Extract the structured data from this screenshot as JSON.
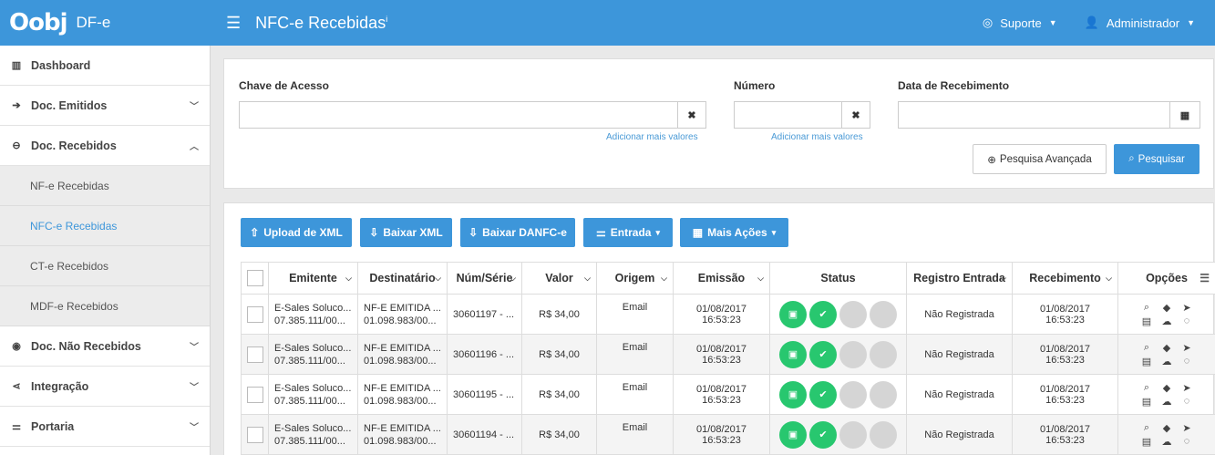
{
  "header": {
    "logo": "Oobj",
    "product": "DF-e",
    "page_title": "NFC-e Recebidas",
    "info_mark": "i",
    "support_label": "Suporte",
    "user_label": "Administrador"
  },
  "sidebar": {
    "items": [
      {
        "label": "Dashboard",
        "icon": "bar-chart-icon"
      },
      {
        "label": "Doc. Emitidos",
        "icon": "arrow-circle-right-icon",
        "expanded": false
      },
      {
        "label": "Doc. Recebidos",
        "icon": "arrow-circle-left-icon",
        "expanded": true
      },
      {
        "label": "Doc. Não Recebidos",
        "icon": "dot-circle-icon",
        "expanded": false
      },
      {
        "label": "Integração",
        "icon": "share-icon",
        "expanded": false
      },
      {
        "label": "Portaria",
        "icon": "sliders-icon",
        "expanded": false
      }
    ],
    "subitems": [
      {
        "label": "NF-e Recebidas",
        "active": false
      },
      {
        "label": "NFC-e Recebidas",
        "active": true
      },
      {
        "label": "CT-e Recebidos",
        "active": false
      },
      {
        "label": "MDF-e Recebidos",
        "active": false
      }
    ]
  },
  "filters": {
    "chave_label": "Chave de Acesso",
    "chave_value": "",
    "numero_label": "Número",
    "numero_value": "",
    "data_label": "Data de Recebimento",
    "data_value": "",
    "add_more": "Adicionar mais valores",
    "adv_search": "Pesquisa Avançada",
    "search": "Pesquisar"
  },
  "actions": {
    "upload_xml": "Upload de XML",
    "baixar_xml": "Baixar XML",
    "baixar_danfce": "Baixar DANFC-e",
    "entrada": "Entrada",
    "mais_acoes": "Mais Ações"
  },
  "table": {
    "columns": [
      "Emitente",
      "Destinatário",
      "Núm/Série",
      "Valor",
      "Origem",
      "Emissão",
      "Status",
      "Registro Entrada",
      "Recebimento",
      "Opções"
    ],
    "rows": [
      {
        "emitente_1": "E-Sales Soluco...",
        "emitente_2": "07.385.111/00...",
        "dest_1": "NF-E EMITIDA ...",
        "dest_2": "01.098.983/00...",
        "num": "30601197 - ...",
        "valor": "R$ 34,00",
        "origem": "Email",
        "emissao_1": "01/08/2017",
        "emissao_2": "16:53:23",
        "registro": "Não Registrada",
        "receb_1": "01/08/2017",
        "receb_2": "16:53:23"
      },
      {
        "emitente_1": "E-Sales Soluco...",
        "emitente_2": "07.385.111/00...",
        "dest_1": "NF-E EMITIDA ...",
        "dest_2": "01.098.983/00...",
        "num": "30601196 - ...",
        "valor": "R$ 34,00",
        "origem": "Email",
        "emissao_1": "01/08/2017",
        "emissao_2": "16:53:23",
        "registro": "Não Registrada",
        "receb_1": "01/08/2017",
        "receb_2": "16:53:23"
      },
      {
        "emitente_1": "E-Sales Soluco...",
        "emitente_2": "07.385.111/00...",
        "dest_1": "NF-E EMITIDA ...",
        "dest_2": "01.098.983/00...",
        "num": "30601195 - ...",
        "valor": "R$ 34,00",
        "origem": "Email",
        "emissao_1": "01/08/2017",
        "emissao_2": "16:53:23",
        "registro": "Não Registrada",
        "receb_1": "01/08/2017",
        "receb_2": "16:53:23"
      },
      {
        "emitente_1": "E-Sales Soluco...",
        "emitente_2": "07.385.111/00...",
        "dest_1": "NF-E EMITIDA ...",
        "dest_2": "01.098.983/00...",
        "num": "30601194 - ...",
        "valor": "R$ 34,00",
        "origem": "Email",
        "emissao_1": "01/08/2017",
        "emissao_2": "16:53:23",
        "registro": "Não Registrada",
        "receb_1": "01/08/2017",
        "receb_2": "16:53:23"
      }
    ]
  },
  "colors": {
    "primary": "#3d96da",
    "status_ok": "#28c76f",
    "status_empty": "#d5d5d5"
  }
}
